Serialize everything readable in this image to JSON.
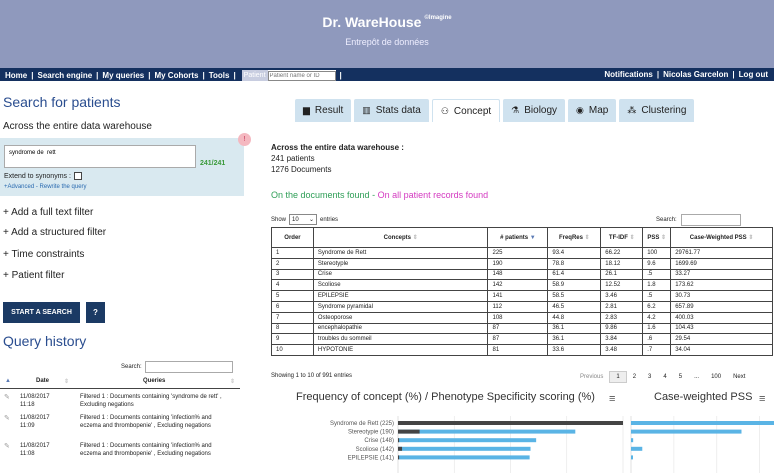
{
  "header": {
    "title": "Dr. WareHouse",
    "title_sup": "©Imagine",
    "subtitle": "Entrepôt de données"
  },
  "nav": {
    "items": [
      "Home",
      "Search engine",
      "My queries",
      "My Cohorts",
      "Tools"
    ],
    "patient_label": "Patient",
    "patient_placeholder": "Patient name or ID",
    "right": [
      "Notifications",
      "Nicolas Garcelon",
      "Log out"
    ]
  },
  "left": {
    "search_title": "Search for patients",
    "scope": "Across the entire data warehouse",
    "query_text": "syndrome de  rett",
    "query_count": "241/241",
    "badge": "!",
    "synonyms_label": "Extend to synonyms :",
    "advanced_link": "+Advanced - Rewrite the query",
    "filters": [
      "+ Add a full text filter",
      "+ Add a structured filter",
      "+ Time constraints",
      "+ Patient filter"
    ],
    "start_button": "START A SEARCH",
    "help_button": "?",
    "history_title": "Query history",
    "history_search_label": "Search:",
    "history_columns": [
      "Date",
      "Queries"
    ],
    "history_rows": [
      {
        "date": "11/08/2017\n11:18",
        "query": "Filtered 1 : Documents containing 'syndrome de rett' , Excluding negations"
      },
      {
        "date": "11/08/2017\n11:09",
        "query": "Filtered 1 : Documents containing 'infection% and eczema and thrombopenie' , Excluding negations"
      },
      {
        "date": "11/08/2017\n11:08",
        "query": "Filtered 1 : Documents containing 'infection% and eczema and thrombopenie' , Excluding negations"
      }
    ]
  },
  "tabs": [
    {
      "icon": "document-icon",
      "glyph": "▆",
      "label": "Result",
      "active": false
    },
    {
      "icon": "bar-chart-icon",
      "glyph": "▥",
      "label": "Stats data",
      "active": false
    },
    {
      "icon": "sitemap-icon",
      "glyph": "⚇",
      "label": "Concept",
      "active": true
    },
    {
      "icon": "flask-icon",
      "glyph": "⚗",
      "label": "Biology",
      "active": false
    },
    {
      "icon": "compass-icon",
      "glyph": "◉",
      "label": "Map",
      "active": false
    },
    {
      "icon": "cluster-icon",
      "glyph": "⁂",
      "label": "Clustering",
      "active": false
    }
  ],
  "summary": {
    "heading": "Across the entire data warehouse :",
    "patients": "241 patients",
    "documents": "1276 Documents"
  },
  "docs_found": {
    "found": "On the documents found",
    "sep": " - ",
    "all": "On all patient records found"
  },
  "table": {
    "show_label": "Show",
    "show_value": "10",
    "entries_label": "entries",
    "search_label": "Search:",
    "columns": [
      "Order",
      "Concepts",
      "# patients",
      "FreqRes",
      "TF-IDF",
      "PSS",
      "Case-Weighted PSS"
    ],
    "rows": [
      [
        "1",
        "Syndrome de Rett",
        "225",
        "93.4",
        "66.22",
        "100",
        "29761.77"
      ],
      [
        "2",
        "Stereotyple",
        "190",
        "78.8",
        "18.12",
        "9.6",
        "1699.69"
      ],
      [
        "3",
        "Crise",
        "148",
        "61.4",
        "26.1",
        ".5",
        "33.27"
      ],
      [
        "4",
        "Scoliose",
        "142",
        "58.9",
        "12.52",
        "1.8",
        "173.62"
      ],
      [
        "5",
        "EPILEPSIE",
        "141",
        "58.5",
        "3.46",
        ".5",
        "30.73"
      ],
      [
        "6",
        "Syndrome pyramidal",
        "112",
        "46.5",
        "2.81",
        "6.2",
        "657.89"
      ],
      [
        "7",
        "Osteoporose",
        "108",
        "44.8",
        "2.83",
        "4.2",
        "400.03"
      ],
      [
        "8",
        "encephalopathie",
        "87",
        "36.1",
        "9.86",
        "1.6",
        "104.43"
      ],
      [
        "9",
        "troubles du sommeil",
        "87",
        "36.1",
        "3.84",
        ".6",
        "29.54"
      ],
      [
        "10",
        "HYPOTONIE",
        "81",
        "33.6",
        "3.48",
        ".7",
        "34.04"
      ]
    ],
    "info": "Showing 1 to 10 of 991 entries",
    "pager": [
      "Previous",
      "1",
      "2",
      "3",
      "4",
      "5",
      "...",
      "100",
      "Next"
    ]
  },
  "charts": {
    "title_left": "Frequency of concept (%) / Phenotype Specificity scoring (%)",
    "title_right": "Case-weighted PSS",
    "bar_color": "#5ab4e5",
    "pss_color": "#444444"
  },
  "chart_data": [
    {
      "type": "bar",
      "title": "Frequency of concept (%) / Phenotype Specificity scoring (%)",
      "categories": [
        "Syndrome de Rett (225)",
        "Stereotypie (190)",
        "Crise (148)",
        "Scoliose (142)",
        "EPILEPSIE (141)"
      ],
      "series": [
        {
          "values": [
            93.4,
            78.8,
            61.4,
            58.9,
            58.5
          ]
        },
        {
          "values": [
            100,
            9.6,
            0.5,
            1.8,
            0.5
          ]
        }
      ]
    },
    {
      "type": "bar",
      "title": "Case-weighted PSS",
      "categories": [
        "Syndrome de Rett (225)",
        "Stereotypie (190)",
        "Crise (148)",
        "Scoliose (142)",
        "EPILEPSIE (141)"
      ],
      "values": [
        29761.77,
        1699.69,
        33.27,
        173.62,
        30.73
      ]
    }
  ]
}
